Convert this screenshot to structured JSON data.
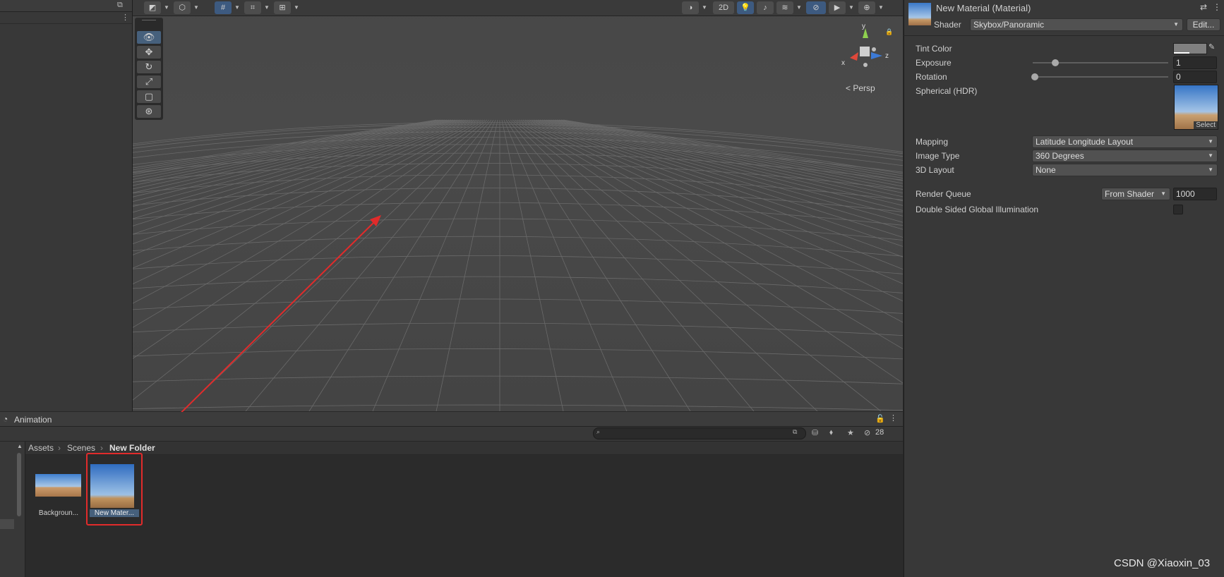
{
  "toolbar": {
    "two_d_label": "2D",
    "hidden_count": "28"
  },
  "scene": {
    "gizmo_y": "y",
    "gizmo_z": "z",
    "gizmo_x": "x",
    "persp_label": "Persp"
  },
  "bottom_panel": {
    "tab_title": "Animation",
    "breadcrumb": [
      "Assets",
      "Scenes",
      "New Folder"
    ],
    "assets": [
      {
        "label": "Backgroun..."
      },
      {
        "label": "New Mater..."
      }
    ]
  },
  "inspector": {
    "title": "New Material (Material)",
    "shader_label": "Shader",
    "shader_value": "Skybox/Panoramic",
    "edit_button": "Edit...",
    "tint_color_label": "Tint Color",
    "exposure_label": "Exposure",
    "exposure_value": "1",
    "exposure_level": 0.15,
    "rotation_label": "Rotation",
    "rotation_value": "0",
    "rotation_level": 0.0,
    "spherical_label": "Spherical  (HDR)",
    "select_label": "Select",
    "mapping_label": "Mapping",
    "mapping_value": "Latitude Longitude Layout",
    "image_type_label": "Image Type",
    "image_type_value": "360 Degrees",
    "layout_label": "3D Layout",
    "layout_value": "None",
    "render_queue_label": "Render Queue",
    "render_queue_mode": "From Shader",
    "render_queue_value": "1000",
    "double_sided_label": "Double Sided Global Illumination"
  },
  "watermark": "CSDN @Xiaoxin_03",
  "colors": {
    "highlight_red": "#e12b2b",
    "selected_blue": "#46607c"
  }
}
